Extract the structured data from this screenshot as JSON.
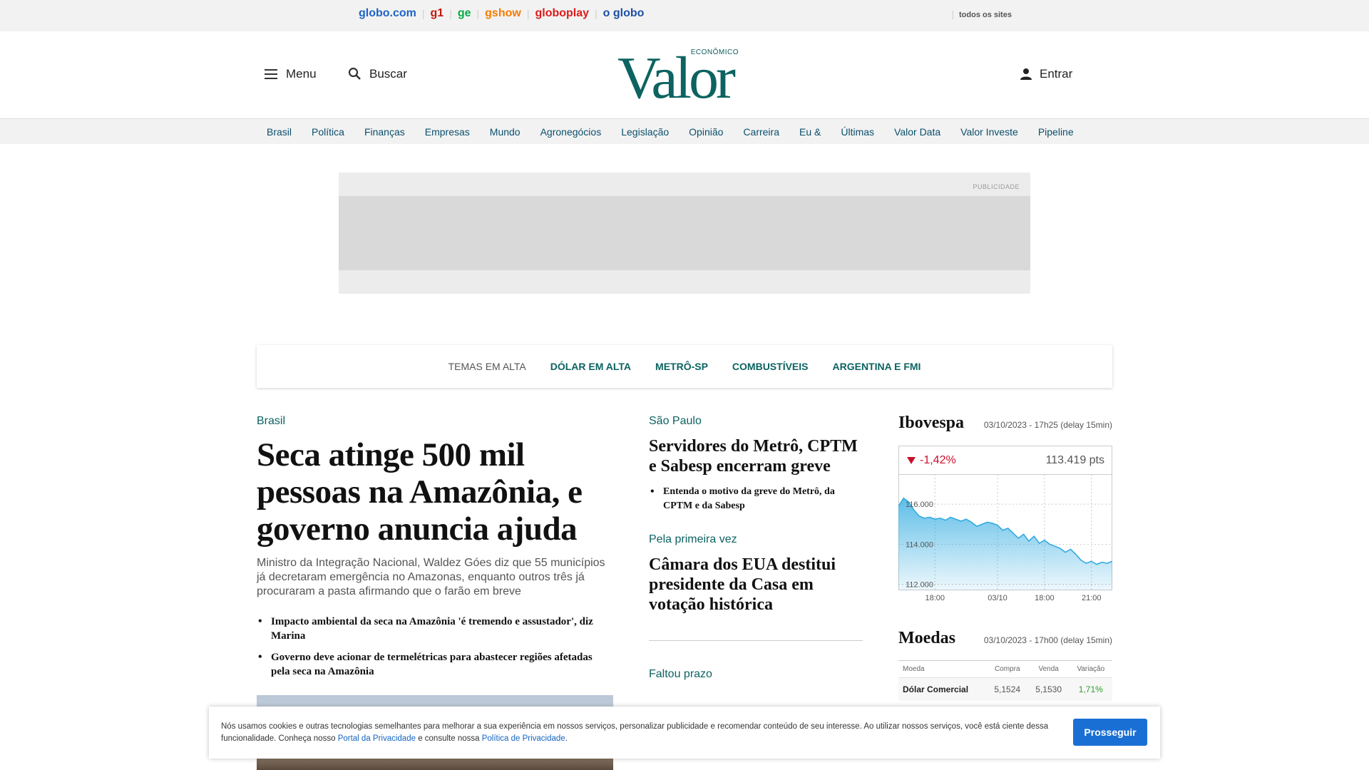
{
  "globo_bar": {
    "brands": [
      {
        "label": "globo.com",
        "color": "#1e64c8"
      },
      {
        "label": "g1",
        "color": "#c4170c"
      },
      {
        "label": "ge",
        "color": "#06aa48"
      },
      {
        "label": "gshow",
        "color": "#f57c00"
      },
      {
        "label": "globoplay",
        "color": "#dc1b1b"
      },
      {
        "label": "o globo",
        "color": "#1e4fa3"
      }
    ],
    "all_sites": "todos os sites"
  },
  "header": {
    "menu_label": "Menu",
    "search_label": "Buscar",
    "logo_word": "Valor",
    "logo_sub": "ECONÔMICO",
    "login_label": "Entrar"
  },
  "sections": [
    "Brasil",
    "Política",
    "Finanças",
    "Empresas",
    "Mundo",
    "Agronegócios",
    "Legislação",
    "Opinião",
    "Carreira",
    "Eu &",
    "Últimas",
    "Valor Data",
    "Valor Investe",
    "Pipeline"
  ],
  "ad": {
    "label": "PUBLICIDADE"
  },
  "trending": {
    "label": "TEMAS EM ALTA",
    "tags": [
      "DÓLAR EM ALTA",
      "METRÔ-SP",
      "COMBUSTÍVEIS",
      "ARGENTINA E FMI"
    ]
  },
  "main_story": {
    "kicker": "Brasil",
    "headline": "Seca atinge 500 mil pessoas na Amazônia, e governo anuncia ajuda",
    "summary": "Ministro da Integração Nacional, Waldez Góes diz que 55 municípios já decretaram emergência no Amazonas, enquanto outros três já procuraram a pasta afirmando que o farão em breve",
    "related": [
      "Impacto ambiental da seca na Amazônia 'é tremendo e assustador', diz Marina",
      "Governo deve acionar de termelétricas para abastecer regiões afetadas pela seca na Amazônia"
    ]
  },
  "middle": [
    {
      "kicker": "São Paulo",
      "headline": "Servidores do Metrô, CPTM e Sabesp encerram greve",
      "related": [
        "Entenda o motivo da greve do Metrô, da CPTM e da Sabesp"
      ]
    },
    {
      "kicker": "Pela primeira vez",
      "headline": "Câmara dos EUA destitui presidente da Casa em votação histórica",
      "related": []
    },
    {
      "kicker": "Faltou prazo",
      "headline": "",
      "related": []
    }
  ],
  "ibovespa": {
    "title": "Ibovespa",
    "date": "03/10/2023 - 17h25 (delay 15min)",
    "change": "-1,42%",
    "points": "113.419 pts",
    "colors": {
      "down": "#c8102e",
      "line": "#29a8e0"
    }
  },
  "chart_data": {
    "type": "area",
    "title": "",
    "xlabel": "",
    "ylabel": "",
    "ylim": [
      111700,
      117500
    ],
    "y_ticks": [
      "116.000",
      "114.000",
      "112.000"
    ],
    "y_tick_values": [
      116000,
      114000,
      112000
    ],
    "x_ticks": [
      "18:00",
      "03/10",
      "18:00",
      "21:00"
    ],
    "x_tick_positions": [
      7,
      19,
      28,
      37
    ],
    "x": [
      0,
      1,
      2,
      3,
      4,
      5,
      6,
      7,
      8,
      9,
      10,
      11,
      12,
      13,
      14,
      15,
      16,
      17,
      18,
      19,
      20,
      21,
      22,
      23,
      24,
      25,
      26,
      27,
      28,
      29,
      30,
      31,
      32,
      33,
      34,
      35,
      36,
      37,
      38,
      39,
      40,
      41
    ],
    "values": [
      115900,
      116300,
      116100,
      115700,
      115400,
      115300,
      115350,
      115250,
      115300,
      115200,
      115350,
      115250,
      115150,
      115250,
      115100,
      114900,
      115000,
      115100,
      115050,
      114950,
      114700,
      114800,
      114550,
      114300,
      114500,
      114150,
      114400,
      114050,
      114200,
      114000,
      113900,
      113800,
      113600,
      113750,
      113500,
      113200,
      113050,
      113150,
      113000,
      113100,
      113050,
      113150
    ]
  },
  "moedas": {
    "title": "Moedas",
    "date": "03/10/2023 - 17h00 (delay 15min)",
    "headers": [
      "Moeda",
      "Compra",
      "Venda",
      "Variação"
    ],
    "rows": [
      {
        "name": "Dólar Comercial",
        "buy": "5,1524",
        "sell": "5,1530",
        "var": "1,71%"
      }
    ],
    "up_color": "#2e9c2e"
  },
  "cookie": {
    "text_1": "Nós usamos cookies e outras tecnologias semelhantes para melhorar a sua experiência em nossos serviços, personalizar publicidade e recomendar conteúdo de seu interesse. Ao utilizar nossos serviços, você está ciente dessa funcionalidade. Conheça nosso ",
    "link_1": "Portal da Privacidade",
    "text_2": " e consulte nossa ",
    "link_2": "Política de Privacidade",
    "text_3": ".",
    "button": "Prosseguir"
  }
}
